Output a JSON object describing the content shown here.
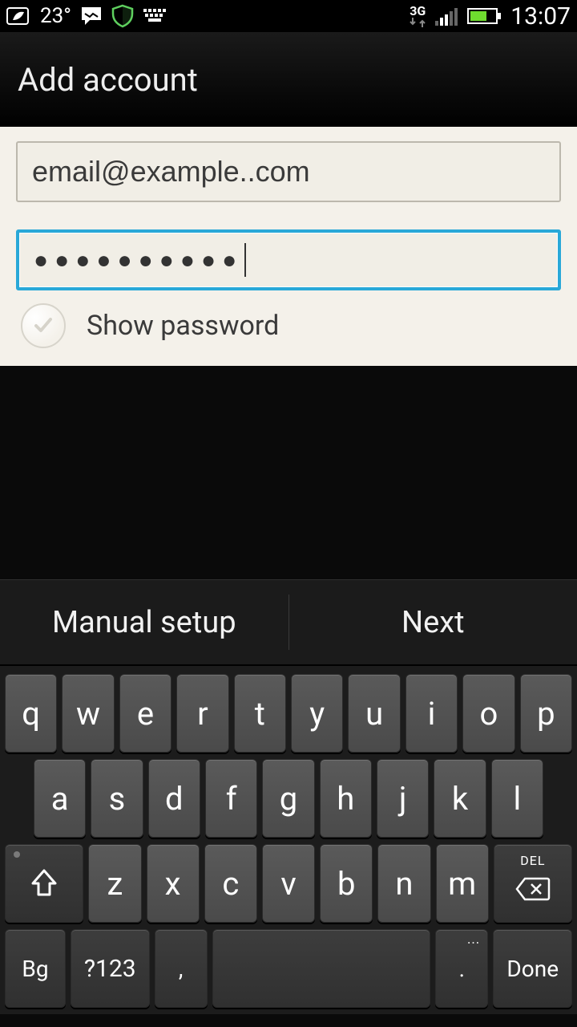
{
  "status": {
    "temperature": "23°",
    "network_label": "3G",
    "clock": "13:07"
  },
  "header": {
    "title": "Add account"
  },
  "form": {
    "email_value": "email@example..com",
    "password_masked": "●●●●●●●●●●",
    "show_password_label": "Show password",
    "show_password_checked": false
  },
  "actions": {
    "manual_setup": "Manual setup",
    "next": "Next"
  },
  "keyboard": {
    "row1": [
      "q",
      "w",
      "e",
      "r",
      "t",
      "y",
      "u",
      "i",
      "o",
      "p"
    ],
    "row2": [
      "a",
      "s",
      "d",
      "f",
      "g",
      "h",
      "j",
      "k",
      "l"
    ],
    "row3_letters": [
      "z",
      "x",
      "c",
      "v",
      "b",
      "n",
      "m"
    ],
    "lang_key": "Bg",
    "sym_key": "?123",
    "comma_key": ",",
    "period_key": ".",
    "done_key": "Done",
    "del_label": "DEL"
  }
}
